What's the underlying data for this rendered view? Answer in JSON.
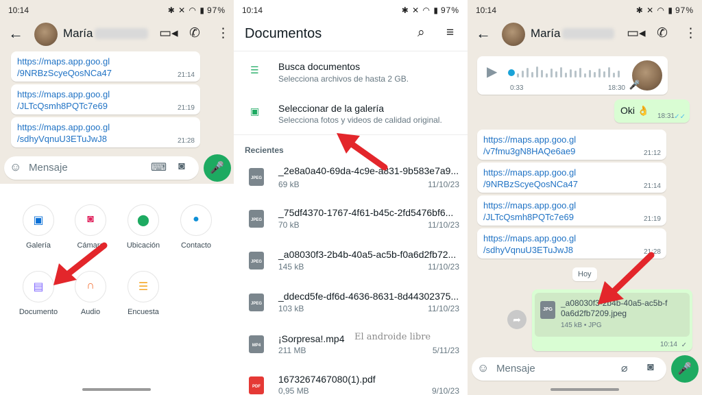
{
  "colors": {
    "accent": "#1daa61",
    "link": "#1f72c4",
    "arrow": "#e3262b",
    "chat_bg": "#efeae2",
    "out_bubble": "#d9fdd3"
  },
  "panel1": {
    "status": {
      "time": "10:14",
      "battery": "97%"
    },
    "contact_name": "María",
    "messages": [
      {
        "line1": "https://maps.app.goo.gl",
        "line2": "/9NRBzScyeQosNCa47",
        "time": "21:14"
      },
      {
        "line1": "https://maps.app.goo.gl",
        "line2": "/JLTcQsmh8PQTc7e69",
        "time": "21:19"
      },
      {
        "line1": "https://maps.app.goo.gl",
        "line2": "/sdhyVqnuU3ETuJwJ8",
        "time": "21:28"
      }
    ],
    "input_placeholder": "Mensaje",
    "attachments": [
      {
        "label": "Galería",
        "icon": "gallery-icon",
        "color": "#0a6fd6"
      },
      {
        "label": "Cámara",
        "icon": "camera-icon",
        "color": "#e0245e"
      },
      {
        "label": "Ubicación",
        "icon": "location-icon",
        "color": "#1daa61"
      },
      {
        "label": "Contacto",
        "icon": "contact-icon",
        "color": "#0e8fd6"
      },
      {
        "label": "Documento",
        "icon": "document-icon",
        "color": "#7f66ff"
      },
      {
        "label": "Audio",
        "icon": "headphones-icon",
        "color": "#f26c2f"
      },
      {
        "label": "Encuesta",
        "icon": "poll-icon",
        "color": "#f5a623"
      }
    ]
  },
  "panel2": {
    "status": {
      "time": "10:14",
      "battery": "97%"
    },
    "title": "Documentos",
    "options": [
      {
        "title": "Busca documentos",
        "subtitle": "Selecciona archivos de hasta 2 GB."
      },
      {
        "title": "Seleccionar de la galería",
        "subtitle": "Selecciona fotos y videos de calidad original."
      }
    ],
    "recent_label": "Recientes",
    "files": [
      {
        "name": "_2e8a0a40-69da-4c9e-a831-9b583e7a9...",
        "size": "69 kB",
        "date": "11/10/23",
        "type": "JPEG",
        "color": "#7b868d"
      },
      {
        "name": "_75df4370-1767-4f61-b45c-2fd5476bf6...",
        "size": "70 kB",
        "date": "11/10/23",
        "type": "JPEG",
        "color": "#7b868d"
      },
      {
        "name": "_a08030f3-2b4b-40a5-ac5b-f0a6d2fb72...",
        "size": "145 kB",
        "date": "11/10/23",
        "type": "JPEG",
        "color": "#7b868d"
      },
      {
        "name": "_ddecd5fe-df6d-4636-8631-8d44302375...",
        "size": "103 kB",
        "date": "11/10/23",
        "type": "JPEG",
        "color": "#7b868d"
      },
      {
        "name": "¡Sorpresa!.mp4",
        "size": "211 MB",
        "date": "5/11/23",
        "type": "MP4",
        "color": "#7b868d"
      },
      {
        "name": "1673267467080(1).pdf",
        "size": "0,95 MB",
        "date": "9/10/23",
        "type": "PDF",
        "color": "#e53935"
      }
    ],
    "watermark": "El androide libre"
  },
  "panel3": {
    "status": {
      "time": "10:14",
      "battery": "97%"
    },
    "contact_name": "María",
    "voice": {
      "duration": "0:33",
      "time": "18:30"
    },
    "reply": {
      "text": "Oki 👌",
      "time": "18:31"
    },
    "messages": [
      {
        "line1": "https://maps.app.goo.gl",
        "line2": "/v7fmu3gN8HAQe6ae9",
        "time": "21:12"
      },
      {
        "line1": "https://maps.app.goo.gl",
        "line2": "/9NRBzScyeQosNCa47",
        "time": "21:14"
      },
      {
        "line1": "https://maps.app.goo.gl",
        "line2": "/JLTcQsmh8PQTc7e69",
        "time": "21:19"
      },
      {
        "line1": "https://maps.app.goo.gl",
        "line2": "/sdhyVqnuU3ETuJwJ8",
        "time": "21:28"
      }
    ],
    "day_chip": "Hoy",
    "file": {
      "line1": "_a08030f3-2b4b-40a5-ac5b-f",
      "line2": "0a6d2fb7209.jpeg",
      "meta": "145 kB • JPG",
      "type": "JPG",
      "time": "10:14"
    },
    "input_placeholder": "Mensaje"
  }
}
